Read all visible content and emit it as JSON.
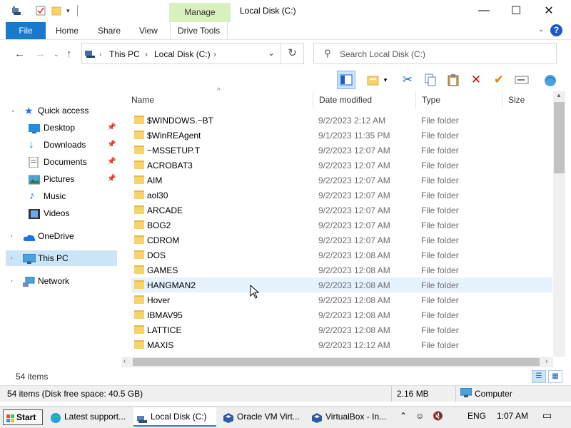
{
  "window": {
    "title": "Local Disk (C:)",
    "manage_tab": "Manage",
    "controls": {
      "minimize": "—",
      "maximize": "☐",
      "close": "✕"
    }
  },
  "ribbon": {
    "tabs": [
      "File",
      "Home",
      "Share",
      "View",
      "Drive Tools"
    ],
    "help": "?"
  },
  "address_bar": {
    "crumbs": [
      "This PC",
      "Local Disk (C:)"
    ],
    "search_placeholder": "Search Local Disk (C:)"
  },
  "nav_pane": {
    "quick_access": "Quick access",
    "quick_items": [
      "Desktop",
      "Downloads",
      "Documents",
      "Pictures",
      "Music",
      "Videos"
    ],
    "onedrive": "OneDrive",
    "this_pc": "This PC",
    "network": "Network"
  },
  "columns": [
    "Name",
    "Date modified",
    "Type",
    "Size"
  ],
  "files": [
    {
      "name": "$WINDOWS.~BT",
      "date": "9/2/2023 2:12 AM",
      "type": "File folder"
    },
    {
      "name": "$WinREAgent",
      "date": "9/1/2023 11:35 PM",
      "type": "File folder"
    },
    {
      "name": "~MSSETUP.T",
      "date": "9/2/2023 12:07 AM",
      "type": "File folder"
    },
    {
      "name": "ACROBAT3",
      "date": "9/2/2023 12:07 AM",
      "type": "File folder"
    },
    {
      "name": "AIM",
      "date": "9/2/2023 12:07 AM",
      "type": "File folder"
    },
    {
      "name": "aol30",
      "date": "9/2/2023 12:07 AM",
      "type": "File folder"
    },
    {
      "name": "ARCADE",
      "date": "9/2/2023 12:07 AM",
      "type": "File folder"
    },
    {
      "name": "BOG2",
      "date": "9/2/2023 12:07 AM",
      "type": "File folder"
    },
    {
      "name": "CDROM",
      "date": "9/2/2023 12:07 AM",
      "type": "File folder"
    },
    {
      "name": "DOS",
      "date": "9/2/2023 12:08 AM",
      "type": "File folder"
    },
    {
      "name": "GAMES",
      "date": "9/2/2023 12:08 AM",
      "type": "File folder"
    },
    {
      "name": "HANGMAN2",
      "date": "9/2/2023 12:08 AM",
      "type": "File folder"
    },
    {
      "name": "Hover",
      "date": "9/2/2023 12:08 AM",
      "type": "File folder"
    },
    {
      "name": "IBMAV95",
      "date": "9/2/2023 12:08 AM",
      "type": "File folder"
    },
    {
      "name": "LATTICE",
      "date": "9/2/2023 12:08 AM",
      "type": "File folder"
    },
    {
      "name": "MAXIS",
      "date": "9/2/2023 12:12 AM",
      "type": "File folder"
    }
  ],
  "hover_row": "HANGMAN2",
  "item_count": "54 items",
  "status": {
    "left": "54 items (Disk free space: 40.5 GB)",
    "size": "2.16 MB",
    "location": "Computer"
  },
  "taskbar": {
    "start": "Start",
    "tasks": [
      "Latest support...",
      "Local Disk (C:)",
      "Oracle VM Virt...",
      "VirtualBox - In..."
    ],
    "active_task": "Local Disk (C:)",
    "language": "ENG",
    "time": "1:07 AM"
  },
  "colors": {
    "file_tab": "#1979ca",
    "manage_tab": "#d8f0c0",
    "selected_nav": "#cce4f7",
    "hover_row": "#e5f3ff"
  }
}
